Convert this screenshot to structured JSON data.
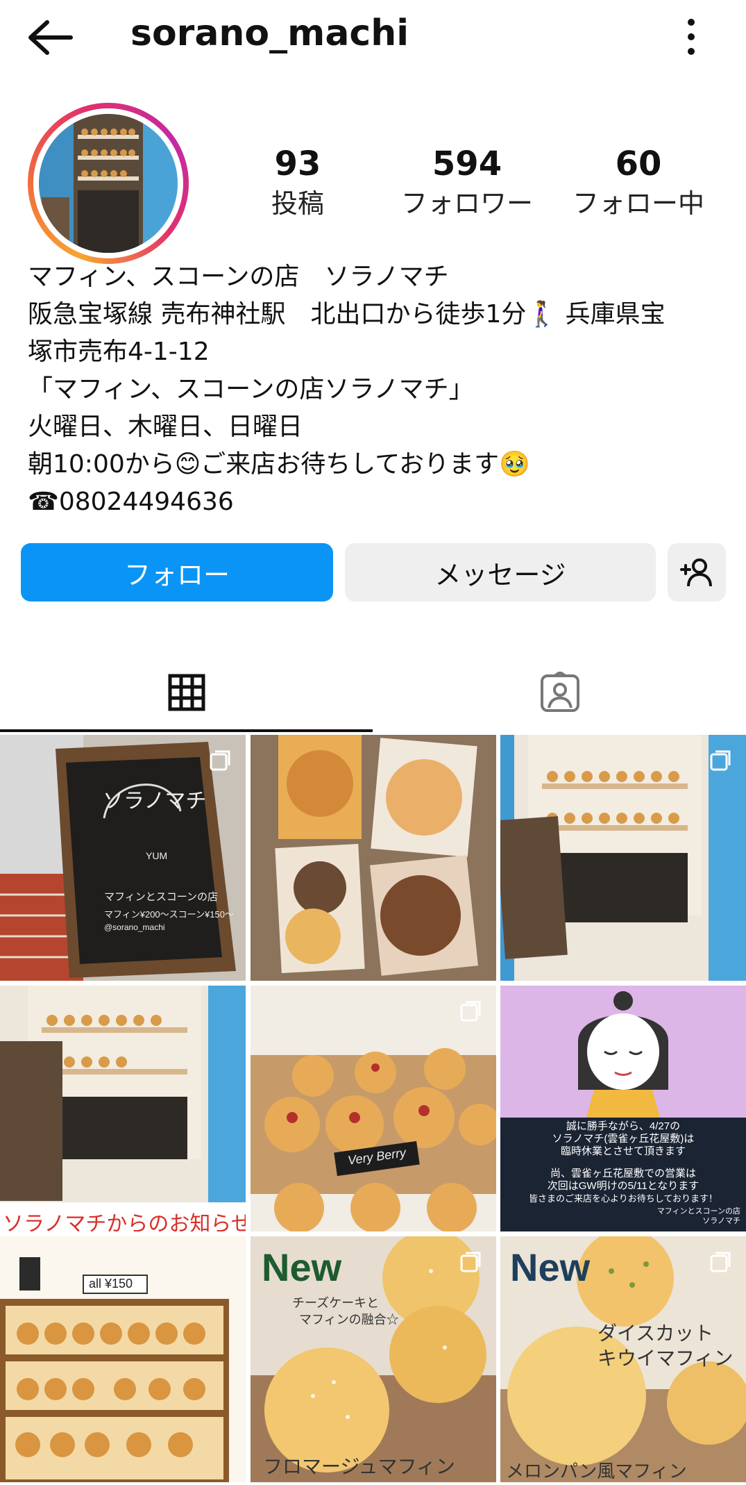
{
  "header": {
    "username": "sorano_machi",
    "back_icon": "arrow-left-icon",
    "menu_icon": "more-vertical-icon"
  },
  "stats": {
    "posts": {
      "value": "93",
      "label": "投稿"
    },
    "followers": {
      "value": "594",
      "label": "フォロワー"
    },
    "following": {
      "value": "60",
      "label": "フォロー中"
    }
  },
  "bio": {
    "lines": [
      "マフィン、スコーンの店　ソラノマチ",
      "阪急宝塚線 売布神社駅　北出口から徒歩1分🚶‍♀️ 兵庫県宝",
      "塚市売布4-1-12",
      "「マフィン、スコーンの店ソラノマチ」",
      "火曜日、木曜日、日曜日",
      "朝10:00から😊ご来店お待ちしております🥹",
      "☎08024494636"
    ]
  },
  "actions": {
    "follow": "フォロー",
    "message": "メッセージ",
    "add_user_icon": "add-user-icon"
  },
  "tabs": {
    "grid_icon": "grid-icon",
    "tagged_icon": "tagged-user-icon"
  },
  "posts": {
    "p1": {
      "sign_title": "ソラノマチ",
      "sign_sub": "マフィンとスコーンの店",
      "sign_price": "マフィン¥200〜スコーン¥150〜",
      "sign_handle": "@sorano_machi",
      "sign_yum": "YUM"
    },
    "p5": {
      "label": "Very Berry"
    },
    "p6": {
      "lines": [
        "誠に勝手ながら、4/27の",
        "ソラノマチ(雲雀ヶ丘花屋敷)は",
        "臨時休業とさせて頂きます",
        "",
        "尚、雲雀ヶ丘花屋敷での営業は",
        "次回はGW明けの5/11となります",
        "皆さまのご来店を心よりお待ちしております！"
      ],
      "footer1": "マフィンとスコーンの店",
      "footer2": "ソラノマチ"
    },
    "p4_banner": "ソラノマチからのお知らせ",
    "p7": {
      "price": "all ¥150"
    },
    "p8": {
      "new": "New",
      "sub1": "チーズケーキと",
      "sub2": "マフィンの融合☆",
      "name": "フロマージュマフィン"
    },
    "p9": {
      "new": "New",
      "title1": "ダイスカット",
      "title2": "キウイマフィン",
      "name": "メロンパン風マフィン"
    }
  }
}
